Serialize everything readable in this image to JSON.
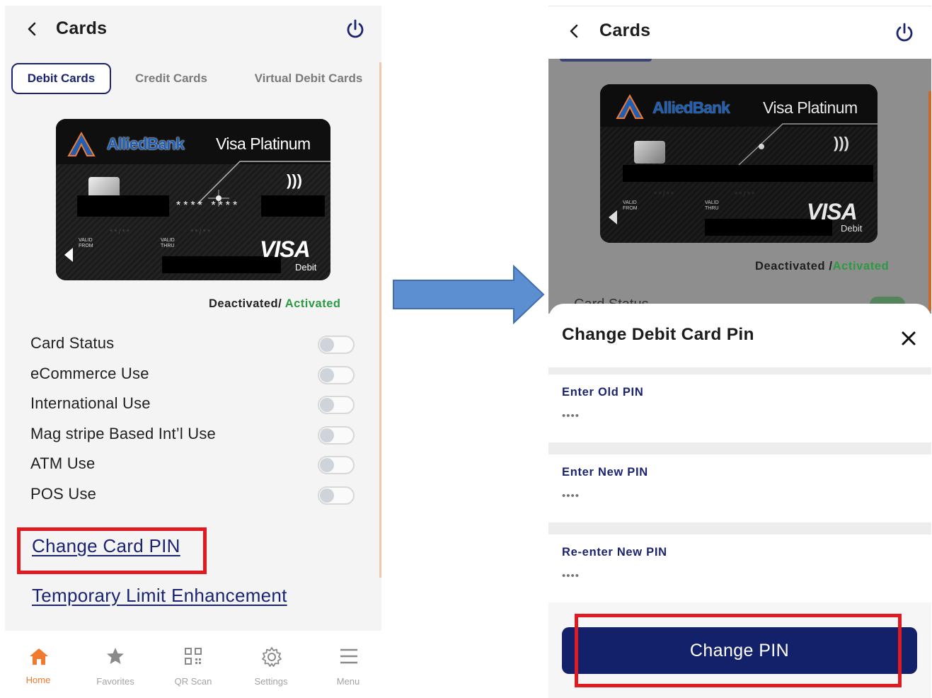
{
  "left": {
    "header": {
      "title": "Cards"
    },
    "tabs": [
      {
        "label": "Debit Cards",
        "active": true
      },
      {
        "label": "Credit Cards",
        "active": false
      },
      {
        "label": "Virtual Debit Cards",
        "active": false
      }
    ],
    "card": {
      "bank_name": "AlliedBank",
      "product": "Visa Platinum",
      "masked_number": "**** ****",
      "valid_from_label": "VALID FROM",
      "valid_thru_label": "VALID THRU",
      "valid_from": "**/**",
      "valid_thru": "**/**",
      "network": "VISA",
      "network_sub": "Debit"
    },
    "status": {
      "deactivated": "Deactivated",
      "separator": "/ ",
      "activated": "Activated",
      "activated_color": "#2d9a43"
    },
    "toggles": [
      {
        "label": "Card Status",
        "on": false
      },
      {
        "label": "eCommerce Use",
        "on": false
      },
      {
        "label": "International Use",
        "on": false
      },
      {
        "label": "Mag stripe Based Int’l Use",
        "on": false
      },
      {
        "label": "ATM Use",
        "on": false
      },
      {
        "label": "POS Use",
        "on": false
      }
    ],
    "links": {
      "change_pin": "Change Card PIN",
      "temp_limit": "Temporary Limit Enhancement"
    },
    "bottom_nav": [
      {
        "label": "Home",
        "icon": "home-icon",
        "active": true
      },
      {
        "label": "Favorites",
        "icon": "star-icon",
        "active": false
      },
      {
        "label": "QR Scan",
        "icon": "qr-icon",
        "active": false
      },
      {
        "label": "Settings",
        "icon": "gear-icon",
        "active": false
      },
      {
        "label": "Menu",
        "icon": "menu-icon",
        "active": false
      }
    ]
  },
  "right": {
    "header": {
      "title": "Cards"
    },
    "card": {
      "bank_name": "AlliedBank",
      "product": "Visa Platinum",
      "valid_from_label": "VALID FROM",
      "valid_thru_label": "VALID THRU",
      "valid_from": "**/**",
      "valid_thru": "**/**",
      "network": "VISA",
      "network_sub": "Debit"
    },
    "status": {
      "deactivated": "Deactivated",
      "separator": " /",
      "activated": "Activated"
    },
    "background_peek_label": "Card Status",
    "sheet": {
      "title": "Change Debit Card Pin",
      "fields": [
        {
          "label": "Enter Old PIN",
          "placeholder": "••••"
        },
        {
          "label": "Enter New PIN",
          "placeholder": "••••"
        },
        {
          "label": "Re-enter New PIN",
          "placeholder": "••••"
        }
      ],
      "submit_label": "Change PIN"
    }
  },
  "colors": {
    "brand_navy": "#13216a",
    "accent_orange": "#f07a2d",
    "highlight_red": "#e11a22",
    "arrow_blue": "#5b8fd1"
  }
}
